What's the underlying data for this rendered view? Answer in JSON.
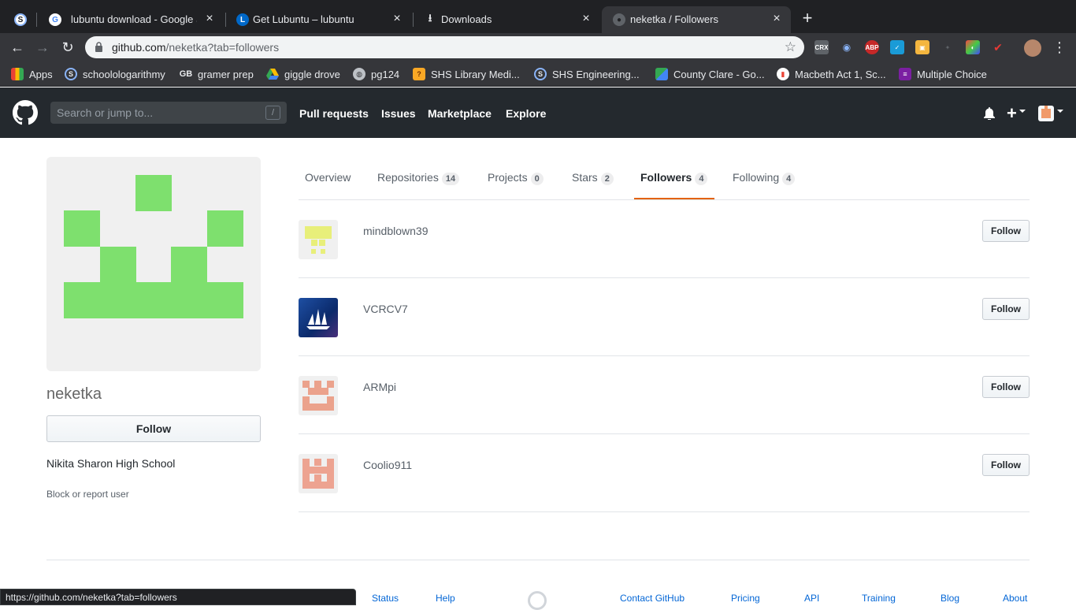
{
  "browser": {
    "tabs": [
      {
        "title": "lubuntu download - Google Se",
        "favicon": "google-icon"
      },
      {
        "title": "Get Lubuntu – lubuntu",
        "favicon": "lubuntu-icon"
      },
      {
        "title": "Downloads",
        "favicon": "download-icon"
      },
      {
        "title": "neketka / Followers",
        "favicon": "github-icon"
      }
    ],
    "url_domain": "github.com",
    "url_path": "/neketka?tab=followers",
    "bookmarks": [
      {
        "label": "Apps"
      },
      {
        "label": "schoolologarithmy"
      },
      {
        "label": "gramer prep"
      },
      {
        "label": "giggle drove"
      },
      {
        "label": "pg124"
      },
      {
        "label": "SHS Library Medi..."
      },
      {
        "label": "SHS Engineering..."
      },
      {
        "label": "County Clare - Go..."
      },
      {
        "label": "Macbeth Act 1, Sc..."
      },
      {
        "label": "Multiple Choice"
      }
    ],
    "extensions": [
      "CRX",
      "ABP"
    ],
    "status_url": "https://github.com/neketka?tab=followers"
  },
  "github": {
    "search_placeholder": "Search or jump to...",
    "search_shortcut": "/",
    "nav": [
      "Pull requests",
      "Issues",
      "Marketplace",
      "Explore"
    ],
    "plus": "+"
  },
  "profile": {
    "username": "neketka",
    "follow_label": "Follow",
    "school": "Nikita Sharon High School",
    "block_label": "Block or report user"
  },
  "tabs": [
    {
      "label": "Overview",
      "count": ""
    },
    {
      "label": "Repositories",
      "count": "14"
    },
    {
      "label": "Projects",
      "count": "0"
    },
    {
      "label": "Stars",
      "count": "2"
    },
    {
      "label": "Followers",
      "count": "4"
    },
    {
      "label": "Following",
      "count": "4"
    }
  ],
  "followers": [
    {
      "name": "mindblown39",
      "button": "Follow"
    },
    {
      "name": "VCRCV7",
      "button": "Follow"
    },
    {
      "name": "ARMpi",
      "button": "Follow"
    },
    {
      "name": "Coolio911",
      "button": "Follow"
    }
  ],
  "footer": {
    "links": [
      "Status",
      "Help",
      "Contact GitHub",
      "Pricing",
      "API",
      "Training",
      "Blog",
      "About"
    ]
  },
  "colors": {
    "accent_tab": "#e36209",
    "avatar_green": "#7ee06e",
    "header_bg": "#24292e"
  }
}
